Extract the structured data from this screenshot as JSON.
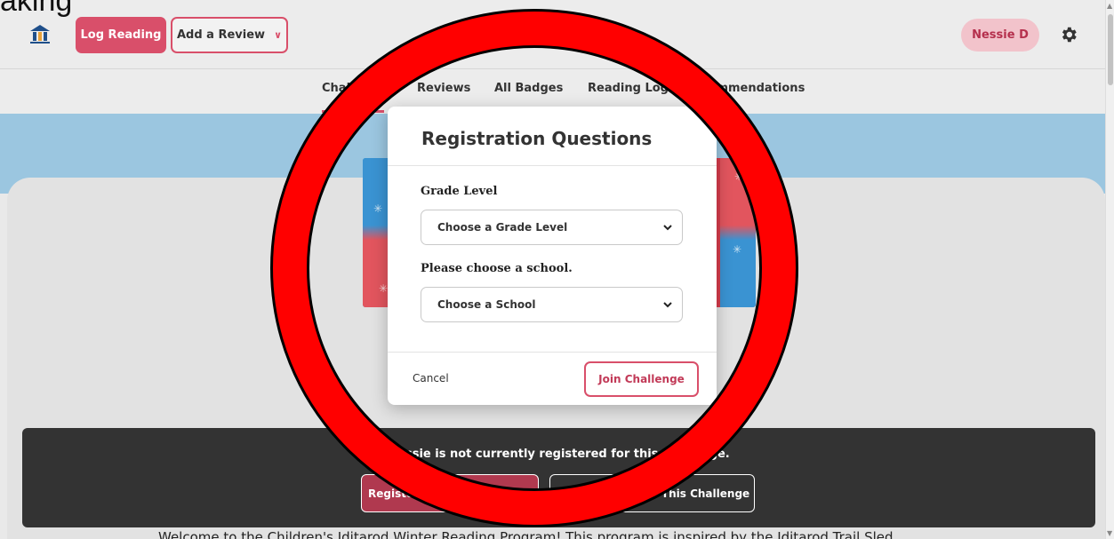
{
  "top_partial_text": "aking",
  "header": {
    "log_label": "Log Reading",
    "review_label": "Add a Review",
    "user_label": "Nessie D"
  },
  "tabs": [
    {
      "label": "Challenges"
    },
    {
      "label": "Reviews"
    },
    {
      "label": "All Badges"
    },
    {
      "label": "Reading Log"
    },
    {
      "label": "Recommendations"
    }
  ],
  "modal": {
    "title": "Registration Questions",
    "grade_label": "Grade Level",
    "grade_value": "Choose a Grade Level",
    "school_label": "Please choose a school.",
    "school_value": "Choose a School",
    "cancel_label": "Cancel",
    "join_label": "Join Challenge"
  },
  "registration": {
    "message": "Nessie is not currently registered for this challenge.",
    "register_label": "Register for This Challenge",
    "not_interested_label": "Not Interested In This Challenge"
  },
  "welcome_text": "Welcome to the Children's Iditarod Winter Reading Program! This program is inspired by the Iditarod Trail Sled",
  "colors": {
    "accent": "#d94f6a",
    "annotation_red": "#ff0000",
    "banner_blue": "#9bc6e0"
  }
}
